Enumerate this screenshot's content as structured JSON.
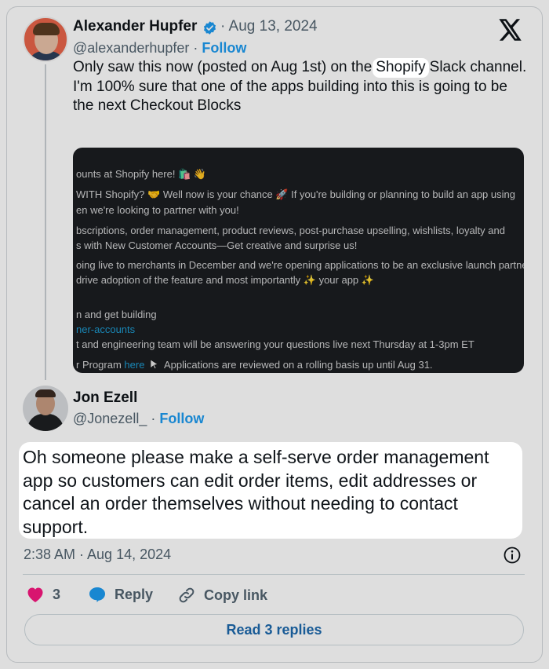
{
  "tweet1": {
    "name": "Alexander Hupfer",
    "date": "· Aug 13, 2024",
    "handle": "@alexanderhupfer",
    "follow": "Follow",
    "text_before": "Only saw this now (posted on Aug 1st) on the",
    "mention": "Shopify",
    "text_after": "Slack channel.",
    "text_line2": "I'm 100% sure that one of the apps building into this is going to be the next Checkout Blocks"
  },
  "embed": {
    "lines": [
      "ounts at Shopify here! 🛍️ 👋",
      "WITH Shopify? 🤝 Well now is your chance 🚀 If you're building or planning to build an app using",
      "en we're looking to partner with you!",
      "bscriptions, order management, product reviews, post-purchase upselling, wishlists, loyalty and",
      "s with New Customer Accounts—Get creative and surprise us!",
      "oing live to merchants in December and we're opening applications to be an exclusive launch partner,",
      "drive adoption of the feature and most importantly ✨ your app ✨",
      "n and get building",
      "ner-accounts",
      "t and engineering team will be answering your questions live next Thursday at 1-3pm ET",
      "r Program",
      "here",
      "Applications are reviewed on a rolling basis up until Aug 31."
    ]
  },
  "tweet2": {
    "name": "Jon Ezell",
    "handle": "@Jonezell_",
    "follow": "Follow",
    "text": "Oh someone please make a self-serve order management app so customers can edit order items, edit addresses or cancel an order themselves without needing to contact support.",
    "timestamp": "2:38 AM · Aug 14, 2024"
  },
  "actions": {
    "likes": "3",
    "reply": "Reply",
    "copy_link": "Copy link",
    "read_replies": "Read 3 replies"
  },
  "colors": {
    "accent": "#1d9bf0",
    "like": "#f91880",
    "reply_icon": "#1d9bf0",
    "text": "#0f1419",
    "muted": "#536471"
  },
  "icons": [
    "x-logo-icon",
    "verified-badge-icon",
    "heart-icon",
    "reply-bubble-icon",
    "link-icon",
    "info-icon",
    "cursor-icon"
  ]
}
